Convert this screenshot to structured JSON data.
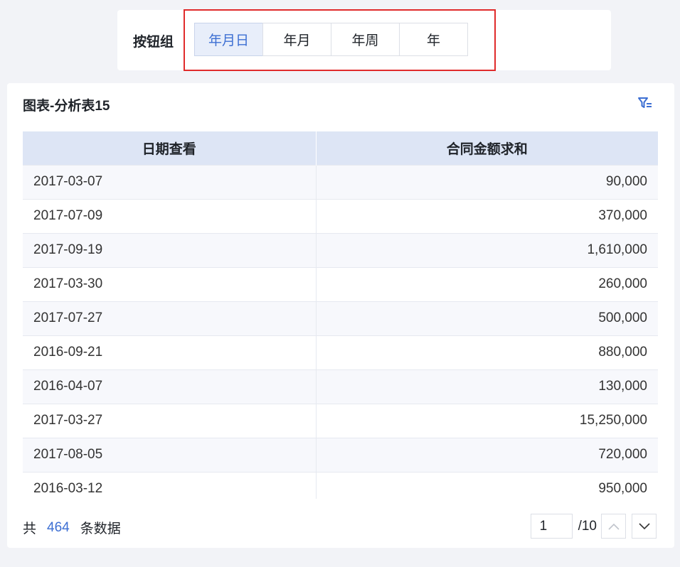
{
  "button_group": {
    "label": "按钮组",
    "options": [
      "年月日",
      "年月",
      "年周",
      "年"
    ],
    "active_index": 0
  },
  "table_card": {
    "title": "图表-分析表15",
    "icon": "filter-icon",
    "columns": [
      "日期查看",
      "合同金额求和"
    ],
    "rows": [
      [
        "2017-03-07",
        "90,000"
      ],
      [
        "2017-07-09",
        "370,000"
      ],
      [
        "2017-09-19",
        "1,610,000"
      ],
      [
        "2017-03-30",
        "260,000"
      ],
      [
        "2017-07-27",
        "500,000"
      ],
      [
        "2016-09-21",
        "880,000"
      ],
      [
        "2016-04-07",
        "130,000"
      ],
      [
        "2017-03-27",
        "15,250,000"
      ],
      [
        "2017-08-05",
        "720,000"
      ],
      [
        "2016-03-12",
        "950,000"
      ]
    ]
  },
  "footer": {
    "total_prefix": "共",
    "total_count": "464",
    "total_suffix": "条数据",
    "page_value": "1",
    "page_total": "/10"
  },
  "colors": {
    "accent": "#3d6fd3",
    "highlight_border": "#e02b2b",
    "header_bg": "#dde5f5"
  }
}
